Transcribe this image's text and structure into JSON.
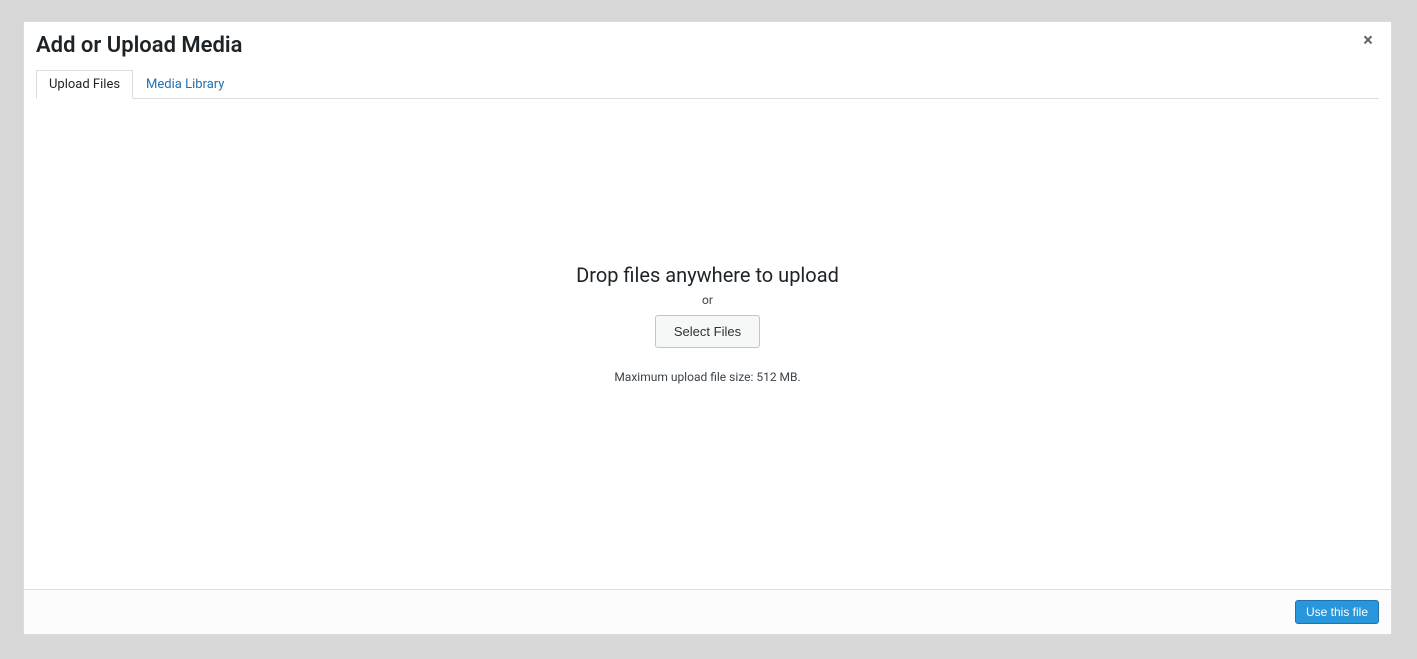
{
  "modal": {
    "title": "Add or Upload Media",
    "close_glyph": "×"
  },
  "tabs": {
    "upload_files": "Upload Files",
    "media_library": "Media Library"
  },
  "upload": {
    "drop_instructions": "Drop files anywhere to upload",
    "or": "or",
    "select_files": "Select Files",
    "max_size": "Maximum upload file size: 512 MB."
  },
  "footer": {
    "use_this_file": "Use this file"
  }
}
